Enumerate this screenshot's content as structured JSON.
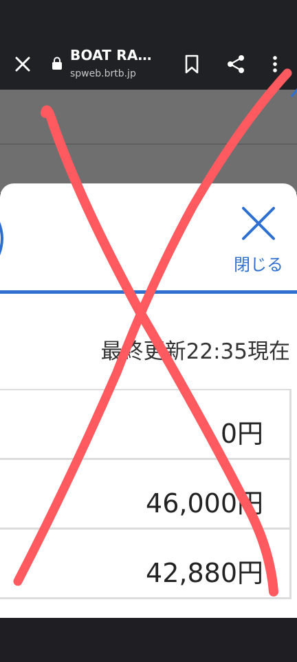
{
  "browser": {
    "title": "BOAT RA…",
    "url": "spweb.brtb.jp",
    "icons": [
      "close-icon",
      "lock-icon",
      "bookmark-icon",
      "share-icon",
      "more-vert-icon"
    ]
  },
  "modal": {
    "close_label": "閉じる",
    "updated_text": "最終更新22:35現在",
    "amounts": [
      "0円",
      "46,000円",
      "42,880円"
    ]
  },
  "annotation": {
    "overlay": "red-x-mark",
    "color": "#ff5a5f"
  },
  "colors": {
    "accent_blue": "#2f6fd0",
    "bar_dark": "#202124"
  }
}
